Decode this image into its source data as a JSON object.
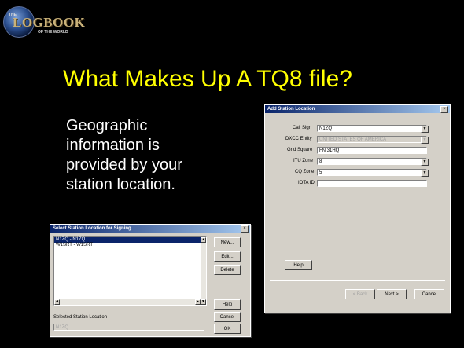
{
  "logo": {
    "the": "THE",
    "main": "LOGBOOK",
    "sub": "OF THE WORLD"
  },
  "slide": {
    "title": "What Makes Up A TQ8 file?",
    "bullet": "Geographic information is provided by your station location."
  },
  "add_dialog": {
    "title": "Add Station Location",
    "close": "×",
    "fields": [
      {
        "label": "Call Sign",
        "value": "N1ZQ",
        "type": "dropdown",
        "enabled": true
      },
      {
        "label": "DXCC Entity",
        "value": "UNITED STATES OF AMERICA",
        "type": "dropdown",
        "enabled": false
      },
      {
        "label": "Grid Square",
        "value": "FN 31HQ",
        "type": "text",
        "enabled": true
      },
      {
        "label": "ITU Zone",
        "value": "8",
        "type": "dropdown",
        "enabled": true
      },
      {
        "label": "CQ Zone",
        "value": "5",
        "type": "dropdown",
        "enabled": true
      },
      {
        "label": "IOTA ID",
        "value": "",
        "type": "text",
        "enabled": true
      }
    ],
    "help": "Help",
    "back": "< Back",
    "next": "Next >",
    "cancel": "Cancel"
  },
  "select_dialog": {
    "title": "Select Station Location for Signing",
    "close": "×",
    "items": [
      {
        "text": "N1ZQ - N1ZQ",
        "selected": true
      },
      {
        "text": "W1SRT - W1SRT",
        "selected": false
      }
    ],
    "new": "New...",
    "edit": "Edit...",
    "delete": "Delete",
    "help": "Help",
    "cancel": "Cancel",
    "ok": "OK",
    "selected_label": "Selected Station Location",
    "selected_value": "N1ZQ"
  },
  "colors": {
    "title": "#ffff00",
    "background": "#000000",
    "dialog": "#d4d0c8",
    "titlebar": "#0a246a"
  }
}
